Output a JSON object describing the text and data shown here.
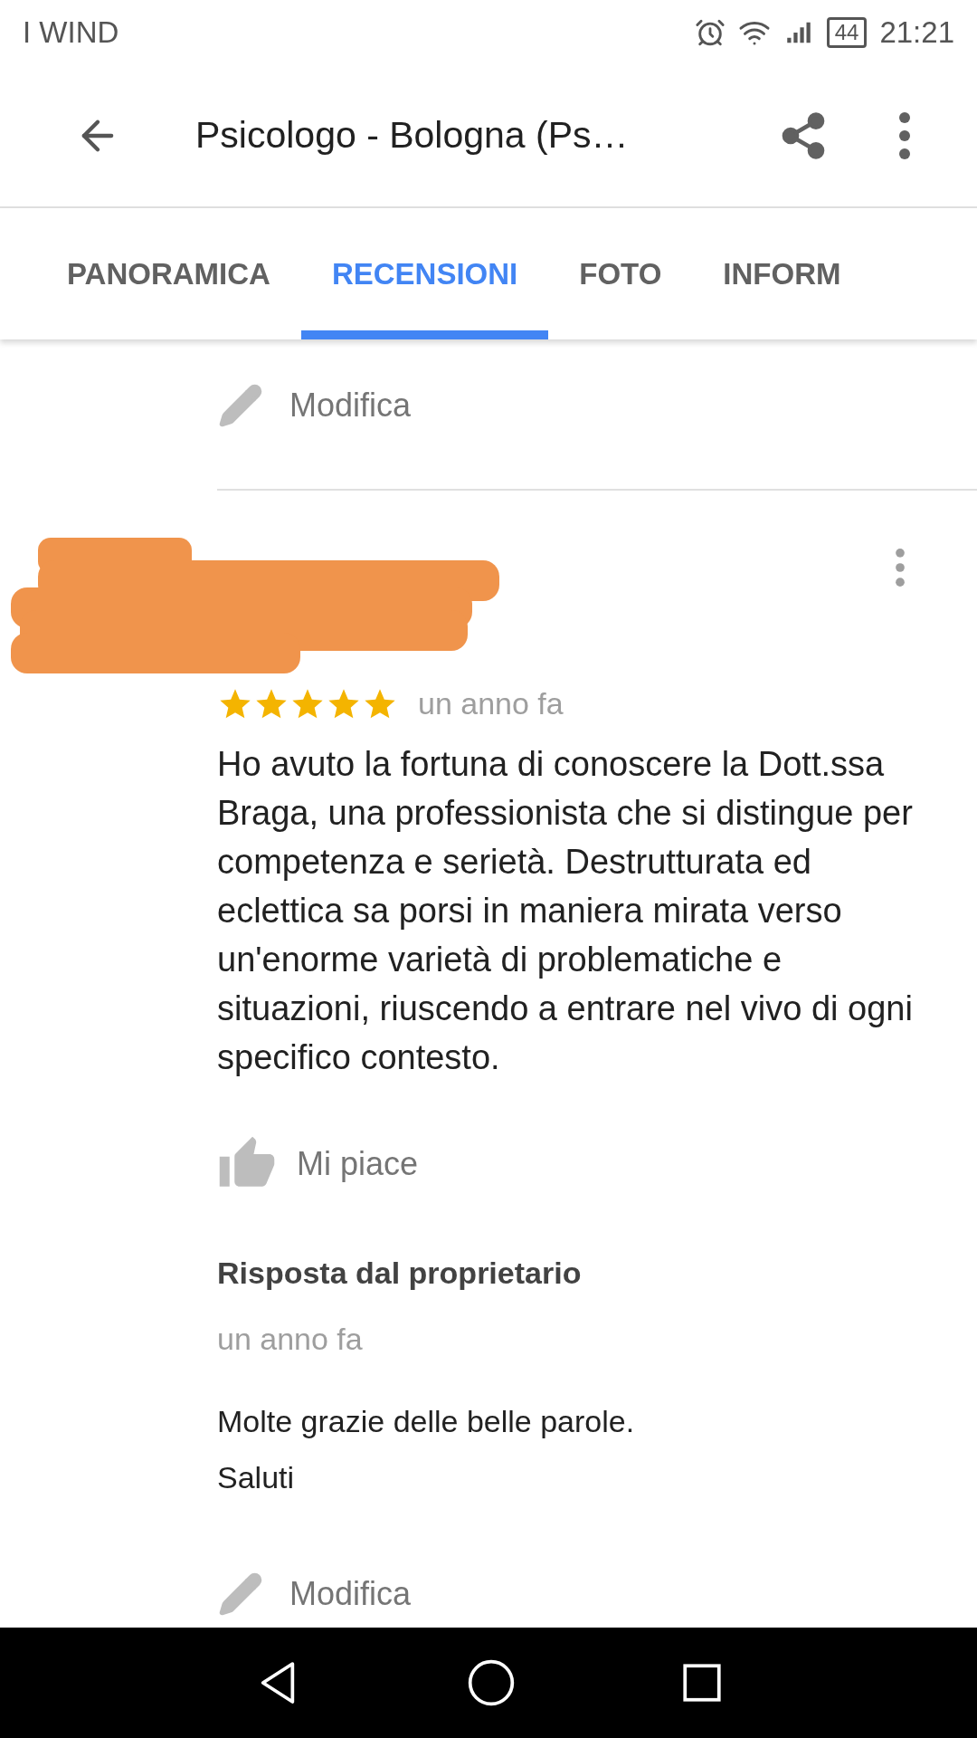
{
  "status_bar": {
    "carrier": "I WIND",
    "battery": "44",
    "time": "21:21"
  },
  "app_bar": {
    "title": "Psicologo - Bologna (Ps…"
  },
  "tabs": [
    {
      "label": "PANORAMICA",
      "selected": false
    },
    {
      "label": "RECENSIONI",
      "selected": true
    },
    {
      "label": "FOTO",
      "selected": false
    },
    {
      "label": "INFORM",
      "selected": false
    }
  ],
  "top_edit": {
    "label": "Modifica"
  },
  "review": {
    "stars": 5,
    "time": "un anno fa",
    "text": "Ho avuto la fortuna di conoscere la Dott.ssa Braga, una professionista che si distingue per competenza e serietà. Destrutturata ed eclettica sa porsi in maniera mirata verso un'enorme varietà di problematiche e situazioni, riuscendo a entrare nel vivo di ogni specifico contesto.",
    "like": {
      "label": "Mi piace"
    },
    "owner_reply": {
      "title": "Risposta dal proprietario",
      "time": "un anno fa",
      "lines": [
        "Molte grazie delle belle parole.",
        "Saluti"
      ]
    },
    "edit": {
      "label": "Modifica"
    }
  }
}
